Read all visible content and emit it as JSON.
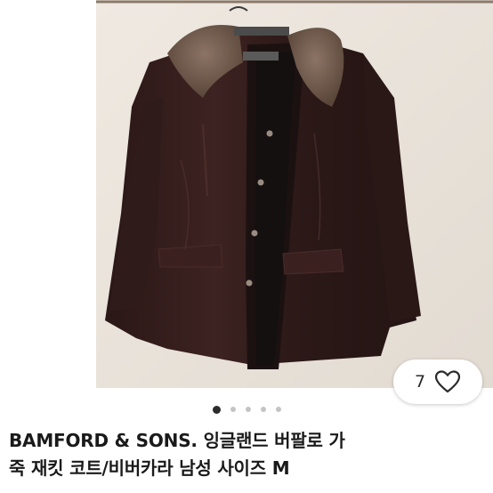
{
  "listing": {
    "title_line1": "BAMFORD & SONS. 잉글랜드 버팔로 가",
    "title_line2": "죽 재킷 코트/비버카라 남성 사이즈 M"
  },
  "likes": {
    "count": "7",
    "icon": "heart-outline-icon"
  },
  "carousel": {
    "total_images": 5,
    "active_index": 0
  },
  "colors": {
    "background": "#ffffff",
    "text": "#1a1a1a",
    "dot_active": "#2b2b2b",
    "dot_inactive": "#c4c4c4"
  }
}
